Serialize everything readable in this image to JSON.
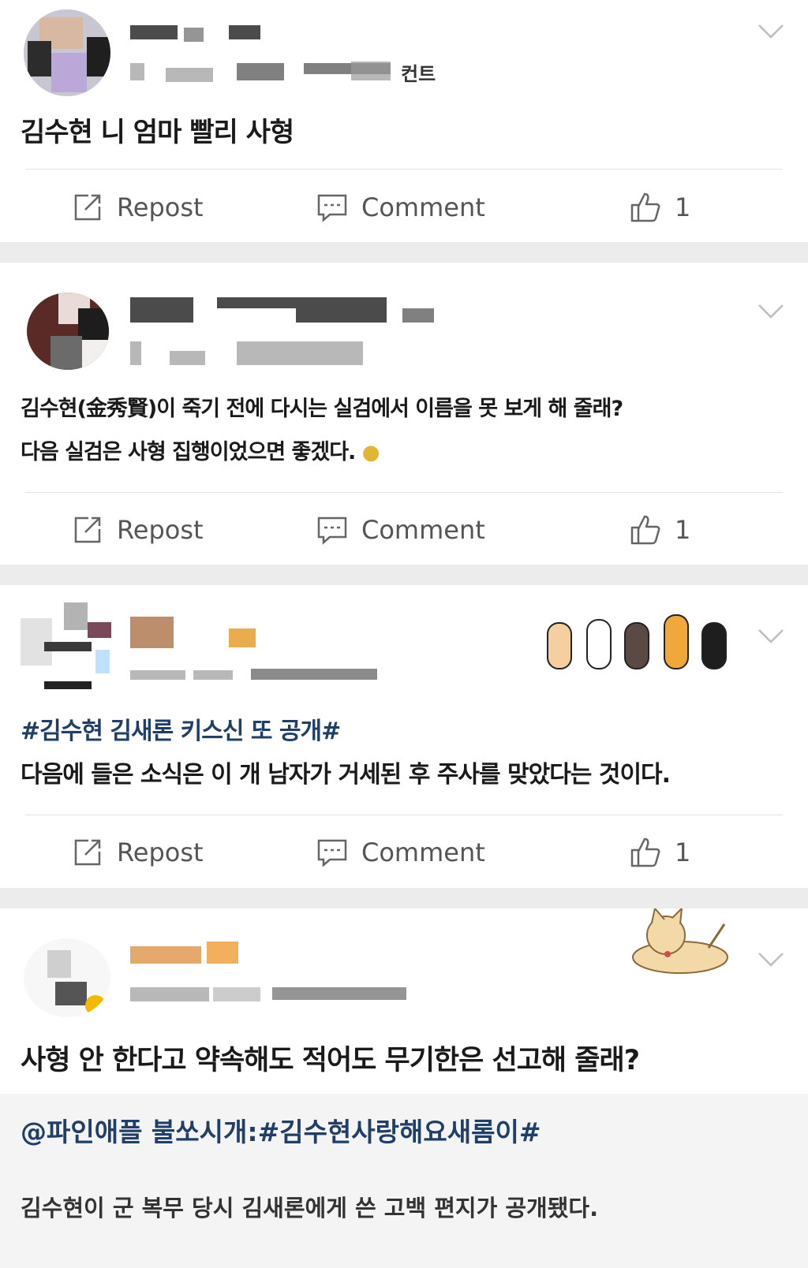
{
  "actions": {
    "repost": "Repost",
    "comment": "Comment"
  },
  "posts": [
    {
      "header_suffix": "컨트",
      "text": "김수현 니 엄마 빨리 사형",
      "likes": "1"
    },
    {
      "text_line1": "김수현(金秀賢)이 죽기 전에 다시는 실검에서 이름을 못 보게 해 줄래?",
      "text_line2": "다음 실검은 사형 집행이었으면 좋겠다.",
      "likes": "1"
    },
    {
      "hashtag": "#김수현 김새론 키스신 또 공개#",
      "text": "다음에 들은 소식은 이 개 남자가 거세된 후 주사를 맞았다는 것이다.",
      "likes": "1"
    },
    {
      "text": "사형 안 한다고 약속해도 적어도 무기한은 선고해 줄래?",
      "quote_link": "@파인애플 불쏘시개:#김수현사랑해요새롬이#",
      "quote_text": "김수현이 군 복무 당시 김새론에게 쓴 고백 편지가 공개됐다."
    }
  ],
  "icons": {
    "repost": "repost-icon",
    "comment": "comment-icon",
    "like": "thumbs-up-icon",
    "menu": "chevron-down-icon"
  },
  "colors": {
    "hashtag": "#1f3f69",
    "separator": "#ececec",
    "action_text": "#555555"
  }
}
